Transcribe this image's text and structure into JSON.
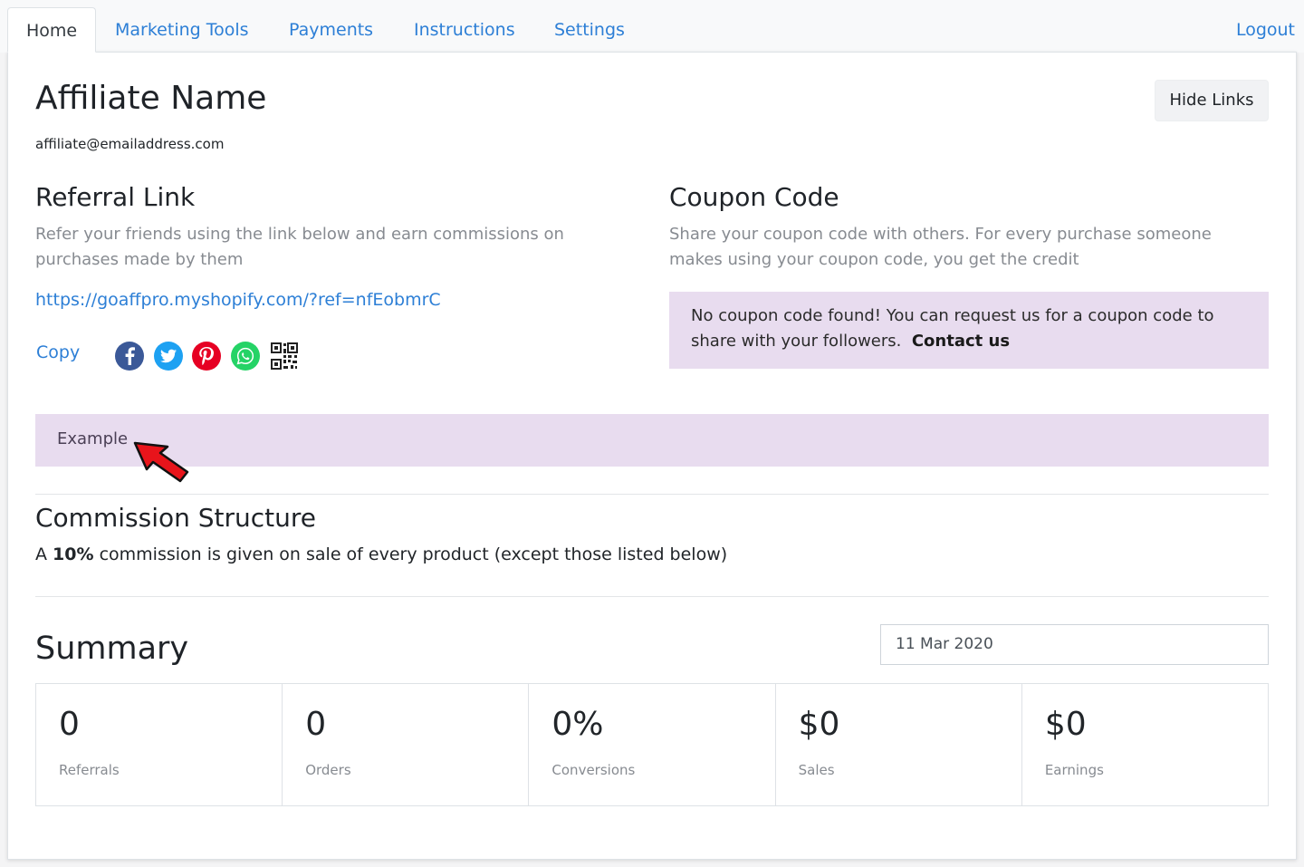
{
  "nav": {
    "tabs": [
      {
        "label": "Home"
      },
      {
        "label": "Marketing Tools"
      },
      {
        "label": "Payments"
      },
      {
        "label": "Instructions"
      },
      {
        "label": "Settings"
      }
    ],
    "logout": "Logout"
  },
  "profile": {
    "name": "Affiliate Name",
    "email": "affiliate@emailaddress.com",
    "hide_links": "Hide Links"
  },
  "referral": {
    "title": "Referral Link",
    "description": "Refer your friends using the link below and earn commissions on purchases made by them",
    "url": "https://goaffpro.myshopify.com/?ref=nfEobmrC",
    "copy_label": "Copy",
    "share_icons": [
      "facebook-icon",
      "twitter-icon",
      "pinterest-icon",
      "whatsapp-icon",
      "qr-code-icon"
    ]
  },
  "coupon": {
    "title": "Coupon Code",
    "description": "Share your coupon code with others. For every purchase someone makes using your coupon code, you get the credit",
    "notice": "No coupon code found! You can request us for a coupon code to share with your followers.",
    "contact": "Contact us"
  },
  "example": {
    "text": "Example",
    "annotation": "red-arrow-icon"
  },
  "commission": {
    "title": "Commission Structure",
    "prefix": "A",
    "rate": "10%",
    "suffix": "commission is given on sale of every product (except those listed below)"
  },
  "summary": {
    "title": "Summary",
    "date": "11 Mar 2020",
    "stats": [
      {
        "value": "0",
        "label": "Referrals"
      },
      {
        "value": "0",
        "label": "Orders"
      },
      {
        "value": "0%",
        "label": "Conversions"
      },
      {
        "value": "$0",
        "label": "Sales"
      },
      {
        "value": "$0",
        "label": "Earnings"
      }
    ]
  },
  "colors": {
    "link": "#2d7fd6",
    "notice_bg": "#e8dcef",
    "facebook": "#3b5998",
    "twitter": "#1da1f2",
    "pinterest": "#e60023",
    "whatsapp": "#25d366",
    "arrow": "#e8141b"
  }
}
